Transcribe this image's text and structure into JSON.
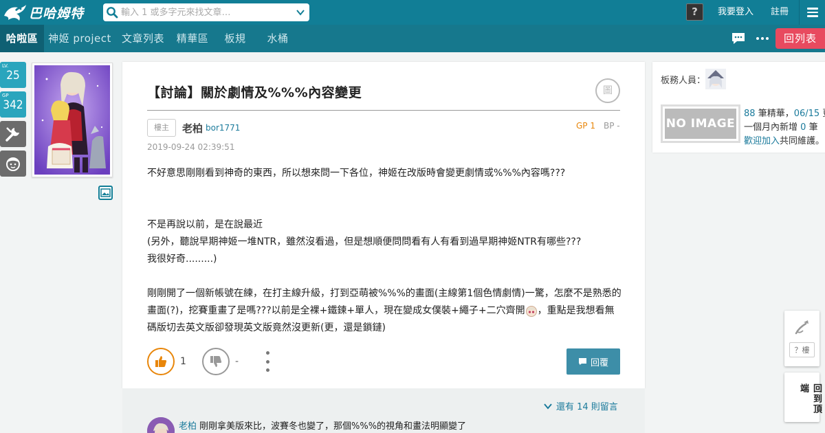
{
  "header": {
    "logo_text": "巴哈姆特",
    "search_placeholder": "輸入 1 或多字元來找文章…",
    "help_glyph": "?",
    "login_label": "我要登入",
    "register_label": "註冊"
  },
  "subnav": {
    "tabs": [
      {
        "label": "哈啦區",
        "active": true
      },
      {
        "label": "神姬 project"
      },
      {
        "label": "文章列表"
      },
      {
        "label": "精華區"
      },
      {
        "label": "板規"
      },
      {
        "label": "水桶"
      }
    ],
    "back_label": "回列表"
  },
  "user": {
    "level_tag": "LV.",
    "level": "25",
    "gp_tag": "GP",
    "gp": "342"
  },
  "post": {
    "title": "【討論】關於劇情及%%%內容變更",
    "title_badge": "圖",
    "floor_tag": "樓主",
    "author_name": "老柏",
    "author_id": "bor1771",
    "gp": "GP 1",
    "bp": "BP -",
    "timestamp": "2019-09-24 02:39:51",
    "body": {
      "line1": "不好意思剛剛看到神奇的東西，所以想來問一下各位，神姬在改版時會變更劇情或%%%內容嗎???",
      "line2": "不是再說以前，是在說最近",
      "line3": "(另外，聽說早期神姬一堆NTR，雖然沒看過，但是想順便問問看有人有看到過早期神姬NTR有哪些???",
      "line4": "我很好奇.........)",
      "para3_a": "剛剛開了一個新帳號在練，在打主線升級，打到亞萌被%%%的畫面(主線第1個色情劇情)一驚，怎麼不是熟悉的畫面(?)，挖賽重畫了是嗎???以前是全裸+鐵鍊+單人，現在變成女僕裝+繩子+二穴齊開",
      "para3_b": "，重點是我想看無碼版切去英文版卻發現英文版竟然沒更新(更，還是鎖鏈)"
    },
    "like_count": "1",
    "dislike_count": "-",
    "reply_label": "回覆"
  },
  "comments": {
    "more_label": "還有 14 則留言",
    "first": {
      "author": "老柏",
      "text": "剛剛拿美版來比，波賽冬也變了，那個%%%的視角和畫法明顯變了"
    }
  },
  "sidebar": {
    "mod_label": "板務人員：",
    "noimage_text": "NO IMAGE",
    "featured_count": "88",
    "featured_label": "筆精華，",
    "featured_date": "06/15",
    "featured_suffix": "更",
    "monthly_label": "一個月內新增",
    "monthly_count": "0",
    "monthly_suffix": "筆",
    "join_link": "歡迎加入",
    "join_suffix": "共同維護。",
    "floor_placeholder": "？樓",
    "vertical_label": "回到頂端"
  },
  "colors": {
    "header_bg": "#117e96",
    "subnav_bg": "#16788d",
    "accent_red": "#e84a5f",
    "link_blue": "#1a7a9b",
    "gp_orange": "#e8860a",
    "badge_teal": "#2aa5bd"
  },
  "icons": [
    "bahamut-dragon-logo",
    "search-icon",
    "chevron-down-icon",
    "menu-icon",
    "chat-bubble-icon",
    "more-horizontal-icon",
    "wrench-icon",
    "face-icon",
    "gallery-icon",
    "thumbs-up-icon",
    "thumbs-down-icon",
    "reply-icon",
    "pen-icon"
  ]
}
